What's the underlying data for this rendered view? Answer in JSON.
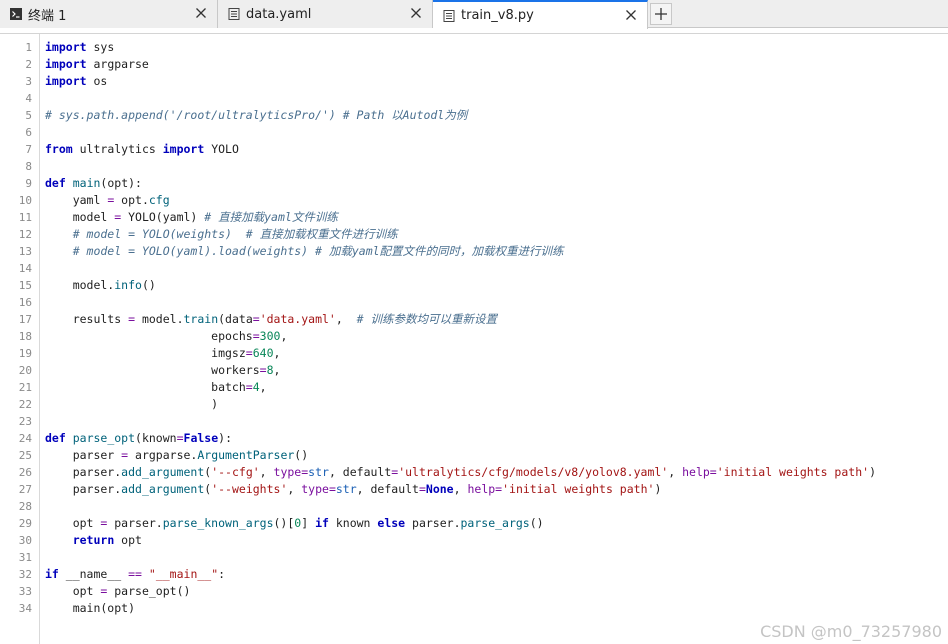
{
  "tabs": [
    {
      "label": "终端 1",
      "icon": "terminal-icon",
      "active": false
    },
    {
      "label": "data.yaml",
      "icon": "document-icon",
      "active": false
    },
    {
      "label": "train_v8.py",
      "icon": "document-icon",
      "active": true
    }
  ],
  "new_tab_icon": "plus-icon",
  "colors": {
    "active_tab_accent": "#1a73e8",
    "keyword": "#0000bb",
    "string": "#a31515",
    "number": "#098658",
    "comment": "#4a6f8f",
    "function": "#00627a"
  },
  "line_numbers": [
    "1",
    "2",
    "3",
    "4",
    "5",
    "6",
    "7",
    "8",
    "9",
    "10",
    "11",
    "12",
    "13",
    "14",
    "15",
    "16",
    "17",
    "18",
    "19",
    "20",
    "21",
    "22",
    "23",
    "24",
    "25",
    "26",
    "27",
    "28",
    "29",
    "30",
    "31",
    "32",
    "33",
    "34"
  ],
  "code_lines": [
    [
      {
        "t": "import",
        "c": "kw"
      },
      {
        "t": " sys",
        "c": ""
      }
    ],
    [
      {
        "t": "import",
        "c": "kw"
      },
      {
        "t": " argparse",
        "c": ""
      }
    ],
    [
      {
        "t": "import",
        "c": "kw"
      },
      {
        "t": " os",
        "c": ""
      }
    ],
    [],
    [
      {
        "t": "# sys.path.append('/root/ultralyticsPro/') # Path 以Autodl为例",
        "c": "cm"
      }
    ],
    [],
    [
      {
        "t": "from",
        "c": "kw"
      },
      {
        "t": " ultralytics ",
        "c": ""
      },
      {
        "t": "import",
        "c": "kw"
      },
      {
        "t": " YOLO",
        "c": ""
      }
    ],
    [],
    [
      {
        "t": "def",
        "c": "kw"
      },
      {
        "t": " ",
        "c": ""
      },
      {
        "t": "main",
        "c": "fn"
      },
      {
        "t": "(opt):",
        "c": ""
      }
    ],
    [
      {
        "t": "    yaml ",
        "c": ""
      },
      {
        "t": "=",
        "c": "op"
      },
      {
        "t": " opt.",
        "c": ""
      },
      {
        "t": "cfg",
        "c": "fn"
      }
    ],
    [
      {
        "t": "    model ",
        "c": ""
      },
      {
        "t": "=",
        "c": "op"
      },
      {
        "t": " YOLO(yaml) ",
        "c": ""
      },
      {
        "t": "# 直接加载yaml文件训练",
        "c": "cm"
      }
    ],
    [
      {
        "t": "    # model = YOLO(weights)  # 直接加载权重文件进行训练",
        "c": "cm"
      }
    ],
    [
      {
        "t": "    # model = YOLO(yaml).load(weights) # 加载yaml配置文件的同时，加载权重进行训练",
        "c": "cm"
      }
    ],
    [],
    [
      {
        "t": "    model.",
        "c": ""
      },
      {
        "t": "info",
        "c": "fn"
      },
      {
        "t": "()",
        "c": ""
      }
    ],
    [],
    [
      {
        "t": "    results ",
        "c": ""
      },
      {
        "t": "=",
        "c": "op"
      },
      {
        "t": " model.",
        "c": ""
      },
      {
        "t": "train",
        "c": "fn"
      },
      {
        "t": "(data",
        "c": ""
      },
      {
        "t": "=",
        "c": "op"
      },
      {
        "t": "'data.yaml'",
        "c": "str"
      },
      {
        "t": ",  ",
        "c": ""
      },
      {
        "t": "# 训练参数均可以重新设置",
        "c": "cm"
      }
    ],
    [
      {
        "t": "                        epochs",
        "c": ""
      },
      {
        "t": "=",
        "c": "op"
      },
      {
        "t": "300",
        "c": "num"
      },
      {
        "t": ",",
        "c": ""
      }
    ],
    [
      {
        "t": "                        imgsz",
        "c": ""
      },
      {
        "t": "=",
        "c": "op"
      },
      {
        "t": "640",
        "c": "num"
      },
      {
        "t": ",",
        "c": ""
      }
    ],
    [
      {
        "t": "                        workers",
        "c": ""
      },
      {
        "t": "=",
        "c": "op"
      },
      {
        "t": "8",
        "c": "num"
      },
      {
        "t": ",",
        "c": ""
      }
    ],
    [
      {
        "t": "                        batch",
        "c": ""
      },
      {
        "t": "=",
        "c": "op"
      },
      {
        "t": "4",
        "c": "num"
      },
      {
        "t": ",",
        "c": ""
      }
    ],
    [
      {
        "t": "                        )",
        "c": ""
      }
    ],
    [],
    [
      {
        "t": "def",
        "c": "kw"
      },
      {
        "t": " ",
        "c": ""
      },
      {
        "t": "parse_opt",
        "c": "fn"
      },
      {
        "t": "(known",
        "c": ""
      },
      {
        "t": "=",
        "c": "op"
      },
      {
        "t": "False",
        "c": "kw"
      },
      {
        "t": "):",
        "c": ""
      }
    ],
    [
      {
        "t": "    parser ",
        "c": ""
      },
      {
        "t": "=",
        "c": "op"
      },
      {
        "t": " argparse.",
        "c": ""
      },
      {
        "t": "ArgumentParser",
        "c": "fn"
      },
      {
        "t": "()",
        "c": ""
      }
    ],
    [
      {
        "t": "    parser.",
        "c": ""
      },
      {
        "t": "add_argument",
        "c": "fn"
      },
      {
        "t": "(",
        "c": ""
      },
      {
        "t": "'--cfg'",
        "c": "str"
      },
      {
        "t": ", ",
        "c": ""
      },
      {
        "t": "type",
        "c": "op"
      },
      {
        "t": "=",
        "c": "op"
      },
      {
        "t": "str",
        "c": "bi"
      },
      {
        "t": ", default",
        "c": ""
      },
      {
        "t": "=",
        "c": "op"
      },
      {
        "t": "'ultralytics/cfg/models/v8/yolov8.yaml'",
        "c": "str"
      },
      {
        "t": ", ",
        "c": ""
      },
      {
        "t": "help",
        "c": "op"
      },
      {
        "t": "=",
        "c": "op"
      },
      {
        "t": "'initial weights path'",
        "c": "str"
      },
      {
        "t": ")",
        "c": ""
      }
    ],
    [
      {
        "t": "    parser.",
        "c": ""
      },
      {
        "t": "add_argument",
        "c": "fn"
      },
      {
        "t": "(",
        "c": ""
      },
      {
        "t": "'--weights'",
        "c": "str"
      },
      {
        "t": ", ",
        "c": ""
      },
      {
        "t": "type",
        "c": "op"
      },
      {
        "t": "=",
        "c": "op"
      },
      {
        "t": "str",
        "c": "bi"
      },
      {
        "t": ", default",
        "c": ""
      },
      {
        "t": "=",
        "c": "op"
      },
      {
        "t": "None",
        "c": "kw"
      },
      {
        "t": ", ",
        "c": ""
      },
      {
        "t": "help",
        "c": "op"
      },
      {
        "t": "=",
        "c": "op"
      },
      {
        "t": "'initial weights path'",
        "c": "str"
      },
      {
        "t": ")",
        "c": ""
      }
    ],
    [],
    [
      {
        "t": "    opt ",
        "c": ""
      },
      {
        "t": "=",
        "c": "op"
      },
      {
        "t": " parser.",
        "c": ""
      },
      {
        "t": "parse_known_args",
        "c": "fn"
      },
      {
        "t": "()[",
        "c": ""
      },
      {
        "t": "0",
        "c": "num"
      },
      {
        "t": "] ",
        "c": ""
      },
      {
        "t": "if",
        "c": "kw"
      },
      {
        "t": " known ",
        "c": ""
      },
      {
        "t": "else",
        "c": "kw"
      },
      {
        "t": " parser.",
        "c": ""
      },
      {
        "t": "parse_args",
        "c": "fn"
      },
      {
        "t": "()",
        "c": ""
      }
    ],
    [
      {
        "t": "    ",
        "c": ""
      },
      {
        "t": "return",
        "c": "kw"
      },
      {
        "t": " opt",
        "c": ""
      }
    ],
    [],
    [
      {
        "t": "if",
        "c": "kw"
      },
      {
        "t": " __name__ ",
        "c": ""
      },
      {
        "t": "==",
        "c": "op"
      },
      {
        "t": " ",
        "c": ""
      },
      {
        "t": "\"__main__\"",
        "c": "str"
      },
      {
        "t": ":",
        "c": ""
      }
    ],
    [
      {
        "t": "    opt ",
        "c": ""
      },
      {
        "t": "=",
        "c": "op"
      },
      {
        "t": " parse_opt()",
        "c": ""
      }
    ],
    [
      {
        "t": "    main(opt)",
        "c": ""
      }
    ]
  ],
  "watermark": "CSDN @m0_73257980"
}
